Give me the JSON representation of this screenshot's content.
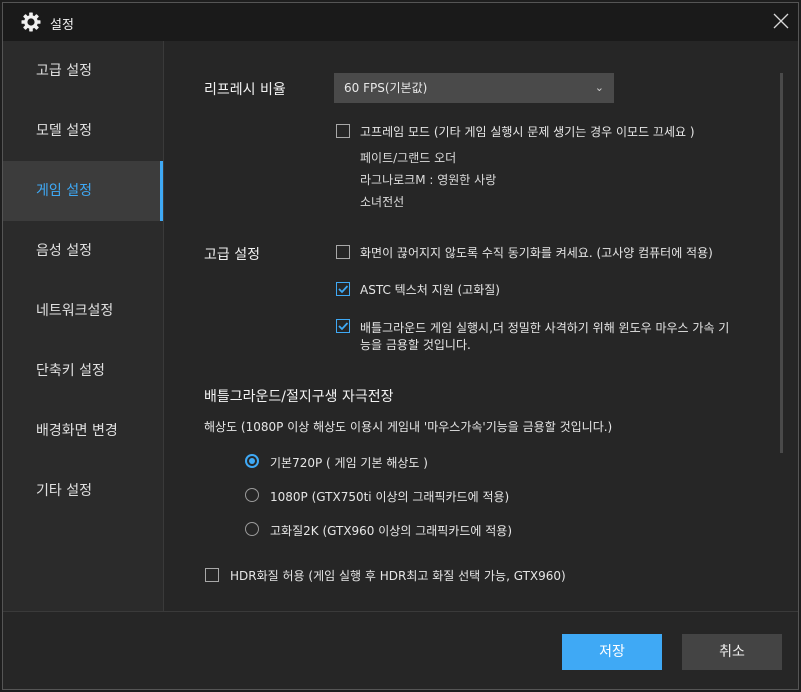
{
  "window": {
    "title": "설정"
  },
  "sidebar": {
    "items": [
      {
        "label": "고급 설정"
      },
      {
        "label": "모델 설정"
      },
      {
        "label": "게임 설정"
      },
      {
        "label": "음성 설정"
      },
      {
        "label": "네트워크설정"
      },
      {
        "label": "단축키 설정"
      },
      {
        "label": "배경화면 변경"
      },
      {
        "label": "기타 설정"
      }
    ],
    "active_index": 2
  },
  "refresh": {
    "label": "리프레시 비율",
    "selected": "60 FPS(기본값)",
    "hiframe_checked": false,
    "hiframe_label": "고프레임 모드  (기타 게임 실행시 문제 생기는 경우 이모드 끄세요 )",
    "games": [
      "페이트/그랜드 오더",
      "라그나로크M : 영원한 사랑",
      "소녀전선"
    ]
  },
  "advanced": {
    "label": "고급 설정",
    "options": [
      {
        "checked": false,
        "line1": "화면이 끊어지지 않도록 수직 동기화를 켜세요.  (고사양 컴퓨터에 적용)",
        "line2": ""
      },
      {
        "checked": true,
        "line1": "ASTC 텍스처 지원 (고화질)",
        "line2": ""
      },
      {
        "checked": true,
        "line1": "배틀그라운드 게임 실행시,더 정밀한 사격하기 위해 윈도우 마우스 가속 기",
        "line2": "능을 금용할 것입니다."
      }
    ]
  },
  "pubg": {
    "heading": "배틀그라운드/절지구생 자극전장",
    "note": "해상도 (1080P 이상 해상도 이용시 게임내  '마우스가속'기능을 금용할 것입니다.)",
    "resolutions": [
      {
        "label": "기본720P ( 게임 기본 해상도 )",
        "selected": true
      },
      {
        "label": "1080P (GTX750ti 이상의 그래픽카드에 적용)",
        "selected": false
      },
      {
        "label": "고화질2K (GTX960 이상의 그래픽카드에 적용)",
        "selected": false
      }
    ],
    "hdr_checked": false,
    "hdr_label": "HDR화질 허용 (게임 실행 후 HDR최고 화질 선택 가능, GTX960)"
  },
  "footer": {
    "save": "저장",
    "cancel": "취소"
  },
  "colors": {
    "accent": "#3fa9f5",
    "background": "#262626",
    "titlebar": "#1a1a1a"
  }
}
